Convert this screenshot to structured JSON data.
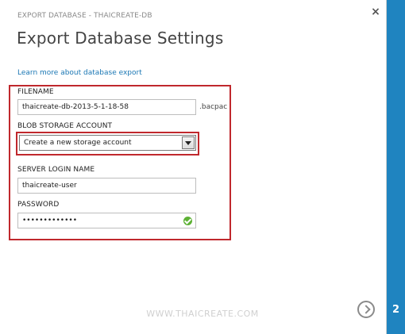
{
  "dialog": {
    "subtitle": "EXPORT DATABASE - THAICREATE-DB",
    "title": "Export Database Settings",
    "close_glyph": "×",
    "learn_more": "Learn more about database export"
  },
  "form": {
    "filename": {
      "label": "FILENAME",
      "value": "thaicreate-db-2013-5-1-18-58",
      "suffix": ".bacpac"
    },
    "blob_storage": {
      "label": "BLOB STORAGE ACCOUNT",
      "selected": "Create a new storage account"
    },
    "server_login": {
      "label": "SERVER LOGIN NAME",
      "value": "thaicreate-user"
    },
    "password": {
      "label": "PASSWORD",
      "value": "•••••••••••••"
    }
  },
  "footer": {
    "watermark": "WWW.THAICREATE.COM"
  },
  "side_panel": {
    "step": "2"
  },
  "colors": {
    "accent": "#1f84c0",
    "highlight": "#c0282d",
    "link": "#1b77b4",
    "valid": "#5db134"
  },
  "icons": {
    "close": "close-icon",
    "dropdown": "chevron-down-icon",
    "valid": "check-circle-icon",
    "next": "arrow-right-circle-icon"
  }
}
